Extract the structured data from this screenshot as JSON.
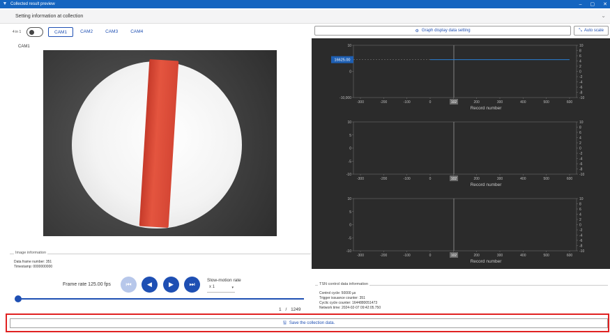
{
  "window": {
    "title": "Collected result preview",
    "minimize": "–",
    "maximize": "▢",
    "close": "✕"
  },
  "section": {
    "title": "Setting information at collection",
    "chevron": "⌄"
  },
  "view": {
    "toggle_label": "4 in 1",
    "cam_tabs": [
      "CAM1",
      "CAM2",
      "CAM3",
      "CAM4"
    ],
    "active_cam": "CAM1",
    "cam_label": "CAM1"
  },
  "image_info": {
    "legend": "Image information",
    "data_frame": "Data frame number: 351",
    "timestamp": "Timestamp: 0000000000"
  },
  "playback": {
    "frame_rate": "Frame rate  125.00 fps",
    "slowmo_label": "Slow-motion rate",
    "slowmo_value": "x 1",
    "progress": 0.0,
    "frame_current": "1",
    "frame_sep": "/",
    "frame_total": "1249"
  },
  "buttons": {
    "graph_setting": "Graph display data setting",
    "auto_scale": "Auto scale",
    "save": "Save the collection data."
  },
  "tsn": {
    "legend": "TSN control data information",
    "lines": [
      "Control cycle: 50000 µs",
      "Trigger issuance counter: 351",
      "Cyclic cycle counter: 1644880051473",
      "Network time: 2024-02-07 09:42:05.750"
    ]
  },
  "colors": {
    "accent": "#1e4fb3",
    "highlight": "#e02020",
    "graph_bg": "#2b2b2b"
  },
  "chart_data": [
    {
      "type": "line",
      "x": [
        0,
        600
      ],
      "ylim": [
        -10,
        10
      ],
      "xlim": [
        -330,
        630
      ],
      "xlabel": "Record number",
      "cursor_x": "102",
      "value_box": "16625.00",
      "left_ticks": [
        "10",
        "0",
        "-10,000"
      ],
      "right_ticks": [
        "10",
        "8",
        "6",
        "4",
        "2",
        "0",
        "-2",
        "-4",
        "-6",
        "-8",
        "-10"
      ],
      "x_ticks": [
        "-300",
        "-200",
        "-100",
        "0",
        "100",
        "200",
        "300",
        "400",
        "500",
        "600"
      ],
      "series": [
        {
          "values": [
            4.5,
            4.5
          ]
        }
      ]
    },
    {
      "type": "line",
      "ylim": [
        -10,
        10
      ],
      "xlim": [
        -330,
        630
      ],
      "xlabel": "Record number",
      "cursor_x": "102",
      "left_ticks": [
        "10",
        "5",
        "0",
        "-5",
        "-10"
      ],
      "right_ticks": [
        "10",
        "8",
        "6",
        "4",
        "2",
        "0",
        "-2",
        "-4",
        "-6",
        "-8",
        "-10"
      ],
      "x_ticks": [
        "-300",
        "-200",
        "-100",
        "0",
        "100",
        "200",
        "300",
        "400",
        "500",
        "600"
      ],
      "series": []
    },
    {
      "type": "line",
      "ylim": [
        -10,
        10
      ],
      "xlim": [
        -330,
        630
      ],
      "xlabel": "Record number",
      "cursor_x": "102",
      "left_ticks": [
        "10",
        "5",
        "0",
        "-5",
        "-10"
      ],
      "right_ticks": [
        "10",
        "8",
        "6",
        "4",
        "2",
        "0",
        "-2",
        "-4",
        "-6",
        "-8",
        "-10"
      ],
      "x_ticks": [
        "-300",
        "-200",
        "-100",
        "0",
        "100",
        "200",
        "300",
        "400",
        "500",
        "600"
      ],
      "series": []
    }
  ]
}
